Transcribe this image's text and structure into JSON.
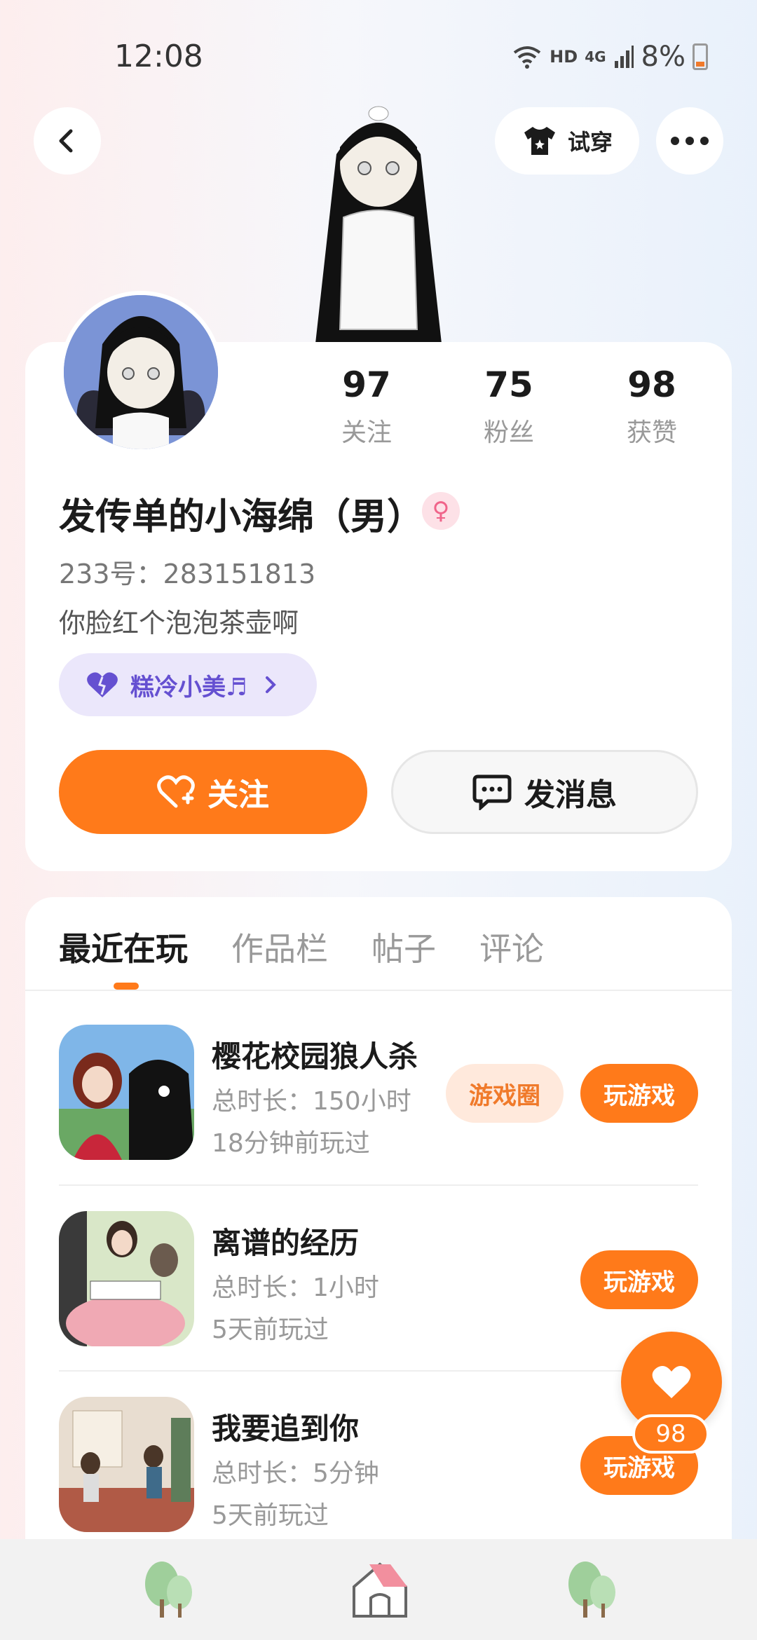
{
  "status_bar": {
    "time": "12:08",
    "hd": "HD",
    "network": "4G",
    "battery": "8%"
  },
  "header": {
    "try_on_label": "试穿"
  },
  "stats": [
    {
      "value": "97",
      "label": "关注"
    },
    {
      "value": "75",
      "label": "粉丝"
    },
    {
      "value": "98",
      "label": "获赞"
    }
  ],
  "profile": {
    "name": "发传单的小海绵（男）",
    "gender_symbol": "♀",
    "uid": "233号：283151813",
    "bio": "你脸红个泡泡茶壶啊",
    "tag": "糕冷小美♬"
  },
  "actions": {
    "follow": "关注",
    "message": "发消息"
  },
  "tabs": [
    "最近在玩",
    "作品栏",
    "帖子",
    "评论"
  ],
  "games": [
    {
      "title": "樱花校园狼人杀",
      "duration": "总时长：150小时",
      "last_played": "18分钟前玩过",
      "circle_label": "游戏圈",
      "play_label": "玩游戏"
    },
    {
      "title": "离谱的经历",
      "duration": "总时长：1小时",
      "last_played": "5天前玩过",
      "play_label": "玩游戏"
    },
    {
      "title": "我要追到你",
      "duration": "总时长：5分钟",
      "last_played": "5天前玩过",
      "play_label": "玩游戏"
    }
  ],
  "like_fab": {
    "count": "98"
  },
  "colors": {
    "accent": "#ff7a1a",
    "purple": "#6550d1",
    "pink": "#f0648a"
  }
}
